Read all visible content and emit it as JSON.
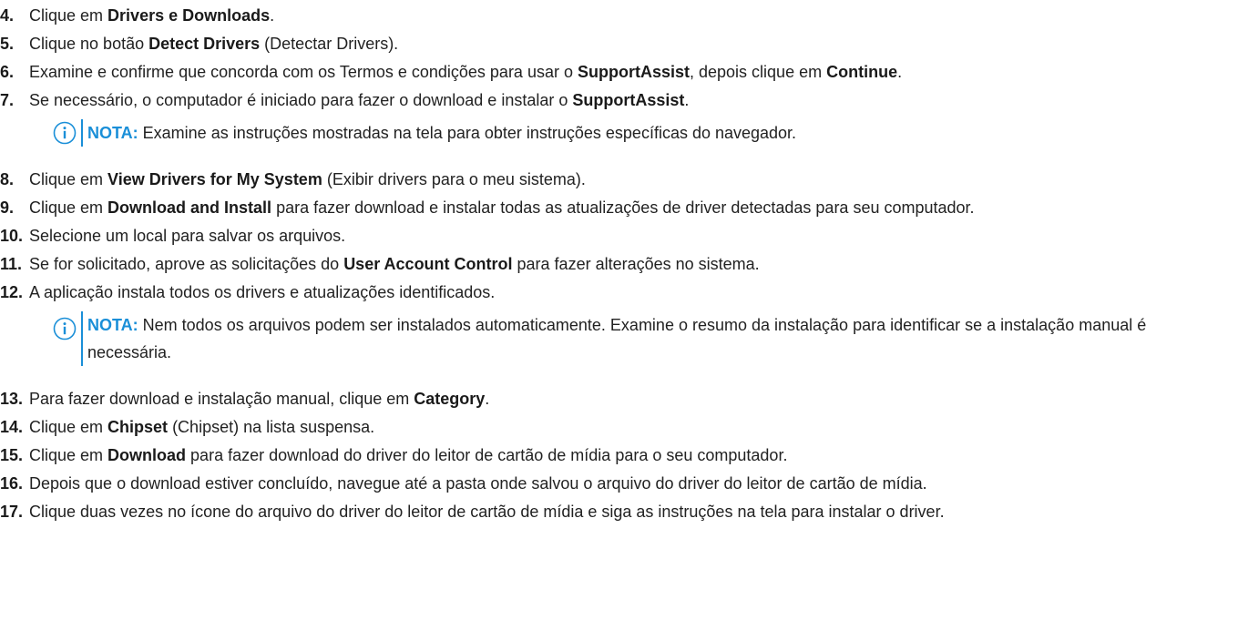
{
  "steps": [
    {
      "num": "4.",
      "parts": [
        {
          "t": "Clique em "
        },
        {
          "t": "Drivers e Downloads",
          "b": true
        },
        {
          "t": "."
        }
      ]
    },
    {
      "num": "5.",
      "parts": [
        {
          "t": "Clique no botão "
        },
        {
          "t": "Detect Drivers",
          "b": true
        },
        {
          "t": " (Detectar Drivers)."
        }
      ]
    },
    {
      "num": "6.",
      "parts": [
        {
          "t": "Examine e confirme que concorda com os Termos e condições para usar o "
        },
        {
          "t": "SupportAssist",
          "b": true
        },
        {
          "t": ", depois clique em "
        },
        {
          "t": "Continue",
          "b": true
        },
        {
          "t": "."
        }
      ]
    },
    {
      "num": "7.",
      "parts": [
        {
          "t": "Se necessário, o computador é iniciado para fazer o download e instalar o "
        },
        {
          "t": "SupportAssist",
          "b": true
        },
        {
          "t": "."
        }
      ]
    },
    {
      "num": "8.",
      "parts": [
        {
          "t": "Clique em "
        },
        {
          "t": "View Drivers for My System",
          "b": true
        },
        {
          "t": " (Exibir drivers para o meu sistema)."
        }
      ]
    },
    {
      "num": "9.",
      "parts": [
        {
          "t": "Clique em "
        },
        {
          "t": "Download and Install",
          "b": true
        },
        {
          "t": " para fazer download e instalar todas as atualizações de driver detectadas para seu computador."
        }
      ]
    },
    {
      "num": "10.",
      "parts": [
        {
          "t": "Selecione um local para salvar os arquivos."
        }
      ]
    },
    {
      "num": "11.",
      "parts": [
        {
          "t": "Se for solicitado, aprove as solicitações do "
        },
        {
          "t": "User Account Control",
          "b": true
        },
        {
          "t": " para fazer alterações no sistema."
        }
      ]
    },
    {
      "num": "12.",
      "parts": [
        {
          "t": "A aplicação instala todos os drivers e atualizações identificados."
        }
      ]
    },
    {
      "num": "13.",
      "parts": [
        {
          "t": "Para fazer download e instalação manual, clique em "
        },
        {
          "t": "Category",
          "b": true
        },
        {
          "t": "."
        }
      ]
    },
    {
      "num": "14.",
      "parts": [
        {
          "t": "Clique em "
        },
        {
          "t": "Chipset",
          "b": true
        },
        {
          "t": " (Chipset) na lista suspensa."
        }
      ]
    },
    {
      "num": "15.",
      "parts": [
        {
          "t": "Clique em "
        },
        {
          "t": "Download",
          "b": true
        },
        {
          "t": " para fazer download do driver do leitor de cartão de mídia para o seu computador."
        }
      ]
    },
    {
      "num": "16.",
      "parts": [
        {
          "t": "Depois que o download estiver concluído, navegue até a pasta onde salvou o arquivo do driver do leitor de cartão de mídia."
        }
      ]
    },
    {
      "num": "17.",
      "parts": [
        {
          "t": "Clique duas vezes no ícone do arquivo do driver do leitor de cartão de mídia e siga as instruções na tela para instalar o driver."
        }
      ]
    }
  ],
  "notes": [
    {
      "label": "NOTA:",
      "text": " Examine as instruções mostradas na tela para obter instruções específicas do navegador.",
      "icon": "info-icon"
    },
    {
      "label": "NOTA:",
      "text": " Nem todos os arquivos podem ser instalados automaticamente. Examine o resumo da instalação para identificar se a instalação manual é necessária.",
      "icon": "info-icon"
    }
  ],
  "colors": {
    "note_accent": "#1a8fd8",
    "text": "#222222"
  }
}
